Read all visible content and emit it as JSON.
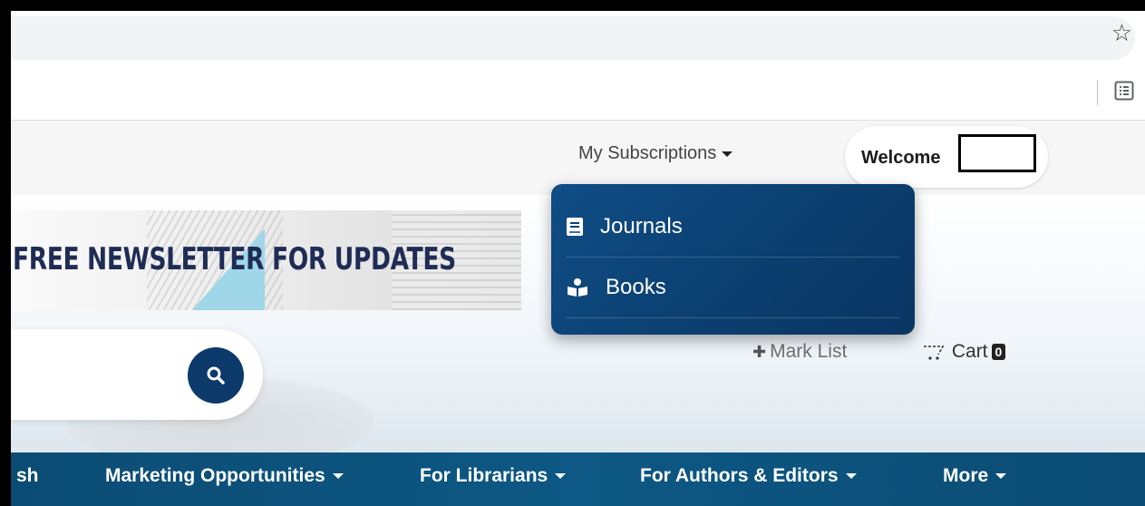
{
  "browser": {
    "star_icon": "star-outline-icon",
    "reading_list_icon": "reading-list-icon"
  },
  "header": {
    "subscriptions_label": "My Subscriptions",
    "welcome_label": "Welcome"
  },
  "dropdown": {
    "items": [
      {
        "label": "Journals",
        "icon": "book-icon"
      },
      {
        "label": "Books",
        "icon": "reader-icon"
      }
    ]
  },
  "hero": {
    "banner_text": "FREE NEWSLETTER FOR UPDATES",
    "mark_list_label": "Mark List",
    "cart_label": "Cart",
    "cart_count": "0"
  },
  "nav": {
    "items": [
      {
        "label": "sh"
      },
      {
        "label": "Marketing Opportunities"
      },
      {
        "label": "For Librarians"
      },
      {
        "label": "For Authors & Editors"
      },
      {
        "label": "More"
      }
    ]
  },
  "colors": {
    "brand_navy": "#0b3a6b",
    "nav_blue": "#0d5884",
    "dropdown_blue": "#0b3f70"
  }
}
